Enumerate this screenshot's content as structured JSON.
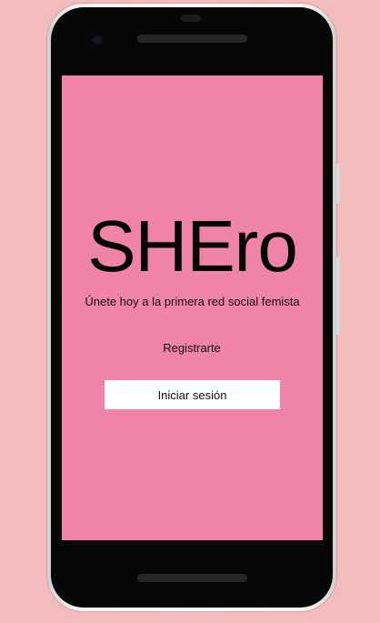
{
  "app": {
    "title": "SHEro",
    "tagline": "Únete hoy a la primera red social femista"
  },
  "actions": {
    "register_label": "Registrarte",
    "login_label": "Iniciar sesión"
  },
  "colors": {
    "page_background": "#f4bdbd",
    "screen_background": "#f083a8",
    "phone_body": "#070707",
    "button_background": "#ffffff",
    "text": "#111111"
  }
}
